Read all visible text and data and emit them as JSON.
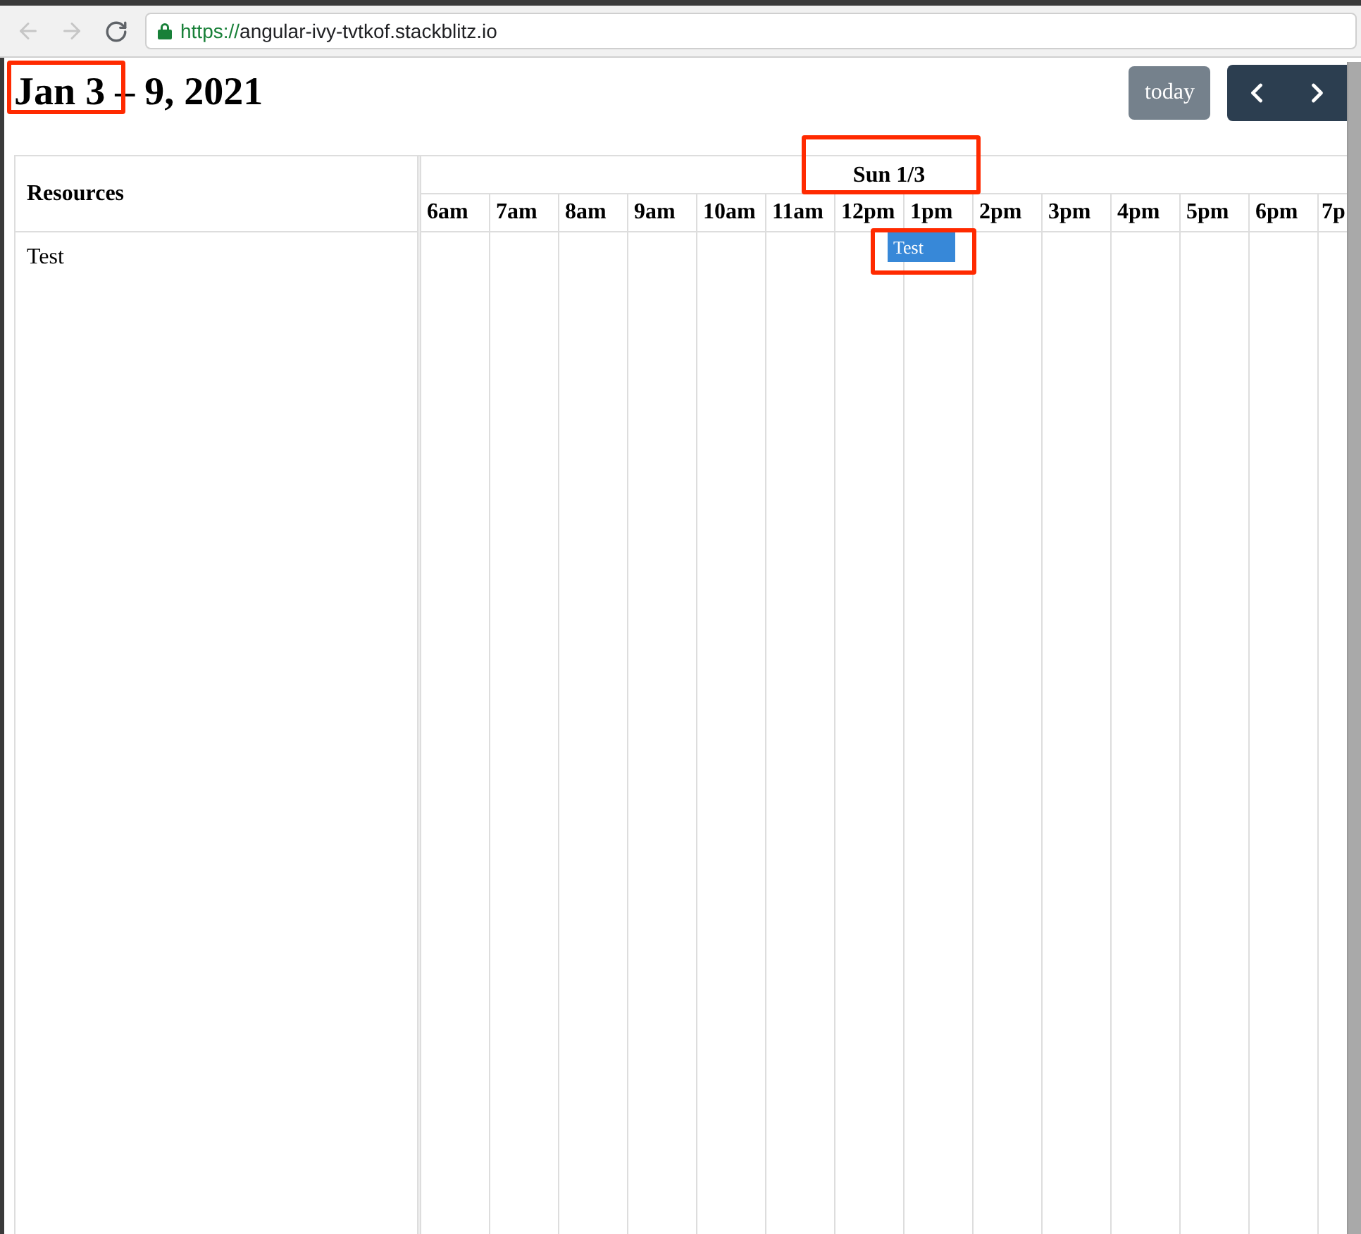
{
  "browser": {
    "nav_buttons": [
      {
        "kind": "back",
        "disabled": true
      },
      {
        "kind": "forward",
        "disabled": true
      },
      {
        "kind": "reload",
        "disabled": false
      }
    ],
    "address": {
      "scheme": "https://",
      "host": "angular-ivy-tvtkof.stackblitz.io"
    }
  },
  "calendar": {
    "title": {
      "text": "Jan 3 – 9, 2021",
      "highlighted": true
    },
    "today_button": {
      "label": "today",
      "disabled": true
    },
    "nav_buttons": [
      {
        "kind": "prev"
      },
      {
        "kind": "next"
      }
    ],
    "resource_header": "Resources",
    "days": [
      {
        "label": "Sun 1/3",
        "highlighted": true
      }
    ],
    "slots": [
      "6am",
      "7am",
      "8am",
      "9am",
      "10am",
      "11am",
      "12pm",
      "1pm",
      "2pm",
      "3pm",
      "4pm",
      "5pm",
      "6pm",
      "7p"
    ],
    "resources": [
      {
        "title": "Test"
      }
    ],
    "events": [
      {
        "title": "Test",
        "highlighted": true
      }
    ]
  }
}
